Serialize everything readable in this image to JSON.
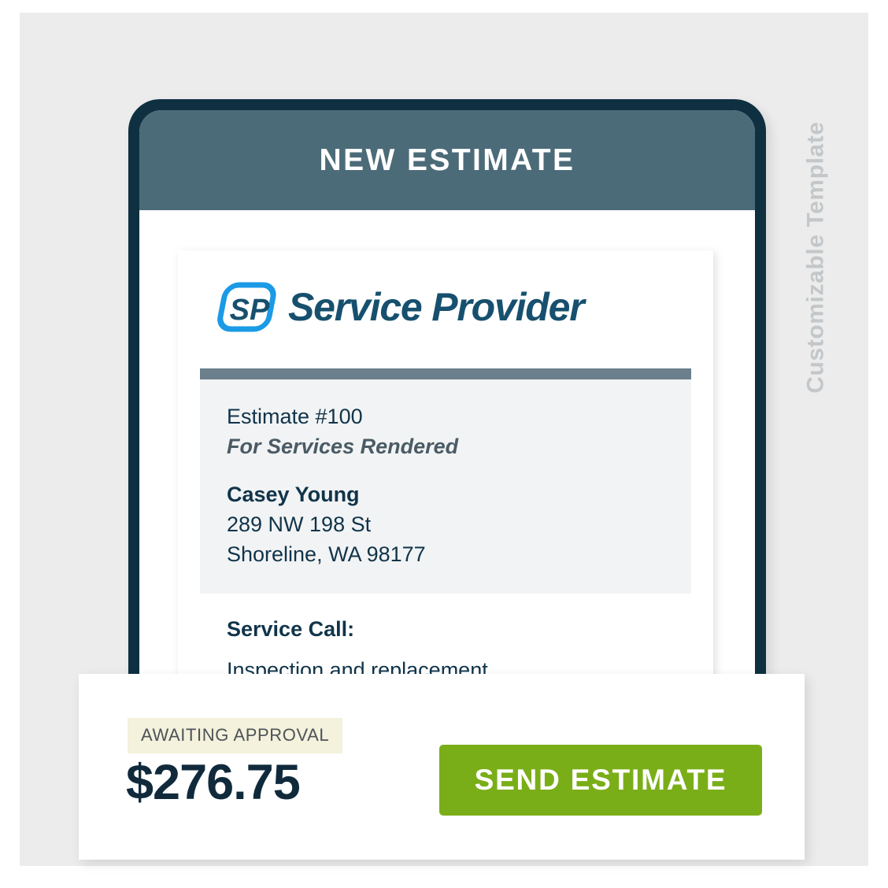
{
  "page": {
    "side_caption": "Customizable Template",
    "backdrop_color": "#ececec",
    "caption_color": "#c3c7ca"
  },
  "phone": {
    "frame_color": "#0e3041",
    "header": {
      "title": "NEW ESTIMATE",
      "background_color": "#4c6b79",
      "text_color": "#ffffff"
    }
  },
  "document": {
    "brand": {
      "mark_text": "SP",
      "name": "Service Provider",
      "mark_outline_color": "#1b9ae6",
      "mark_text_color": "#17506e",
      "name_color": "#17506e"
    },
    "rule_color": "#6b808c",
    "estimate_number": "Estimate #100",
    "estimate_subtitle": "For Services Rendered",
    "customer_name": "Casey Young",
    "customer_address_line1": "289 NW 198 St",
    "customer_address_line2": "Shoreline, WA 98177",
    "service_label": "Service Call:",
    "service_description": "Inspection and replacement."
  },
  "summary": {
    "status_label": "AWAITING APPROVAL",
    "status_background_color": "#f4f1dc",
    "total_amount": "$276.75",
    "total_color": "#102a3c",
    "send_button_label": "SEND ESTIMATE",
    "send_button_color": "#7aae18"
  }
}
